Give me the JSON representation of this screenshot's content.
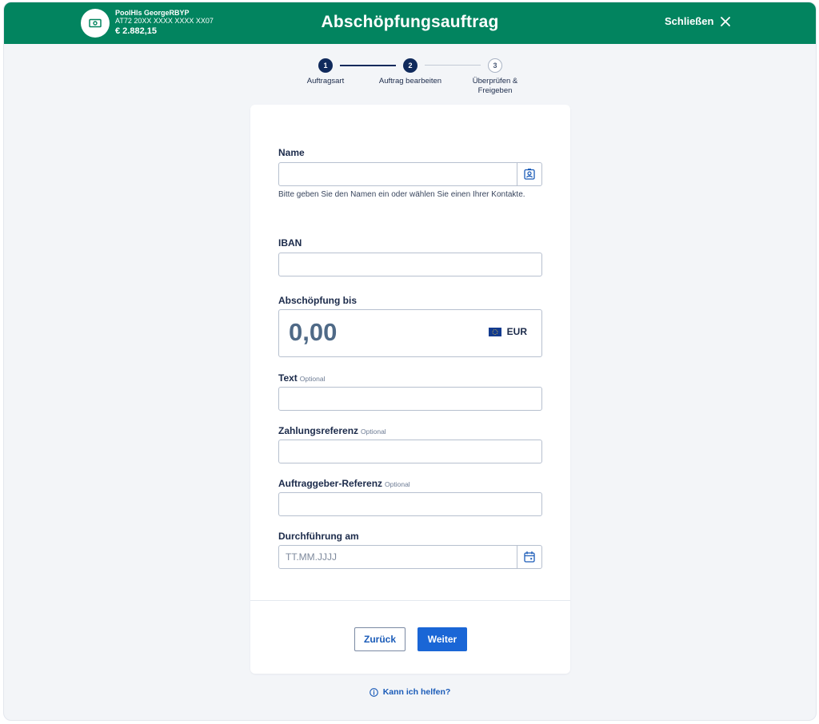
{
  "header": {
    "title": "Abschöpfungsauftrag",
    "close_label": "Schließen",
    "account": {
      "name": "PoolHls GeorgeRBYP",
      "iban": "AT72 20XX XXXX XXXX XX07",
      "balance": "€ 2.882,15"
    }
  },
  "stepper": {
    "steps": [
      {
        "number": "1",
        "label": "Auftragsart",
        "state": "done"
      },
      {
        "number": "2",
        "label": "Auftrag bearbeiten",
        "state": "active"
      },
      {
        "number": "3",
        "label": "Überprüfen & Freigeben",
        "state": "todo"
      }
    ]
  },
  "form": {
    "name": {
      "label": "Name",
      "value": "",
      "placeholder": "",
      "hint": "Bitte geben Sie den Namen ein oder wählen Sie einen Ihrer Kontakte."
    },
    "iban": {
      "label": "IBAN",
      "value": "",
      "placeholder": ""
    },
    "amount": {
      "label": "Abschöpfung bis",
      "value": "0,00",
      "currency": "EUR"
    },
    "text": {
      "label": "Text",
      "optional": "Optional",
      "value": "",
      "placeholder": ""
    },
    "payment_reference": {
      "label": "Zahlungsreferenz",
      "optional": "Optional",
      "value": "",
      "placeholder": ""
    },
    "orderer_reference": {
      "label": "Auftraggeber-Referenz",
      "optional": "Optional",
      "value": "",
      "placeholder": ""
    },
    "execution_date": {
      "label": "Durchführung am",
      "value": "",
      "placeholder": "TT.MM.JJJJ"
    }
  },
  "actions": {
    "back_label": "Zurück",
    "next_label": "Weiter"
  },
  "help": {
    "label": "Kann ich helfen?"
  },
  "colors": {
    "header_green": "#02845f",
    "primary_blue": "#1a66d6",
    "navy": "#102a5c"
  }
}
